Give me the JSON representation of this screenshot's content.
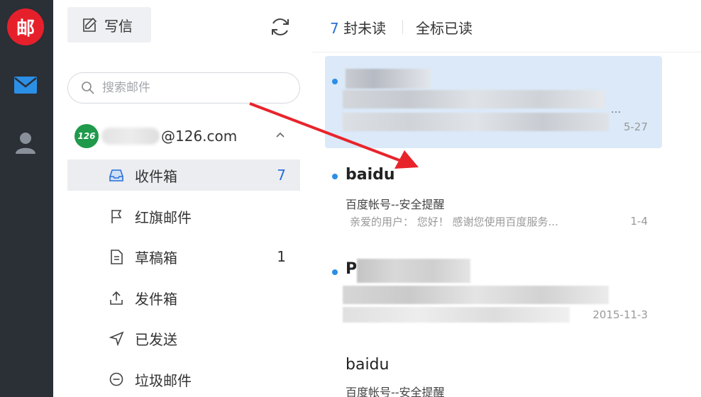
{
  "rail": {
    "logo_text": "邮",
    "icons": [
      "mail-icon",
      "contact-icon"
    ]
  },
  "nav": {
    "compose_label": "写信",
    "search_placeholder": "搜索邮件",
    "account": {
      "badge": "126",
      "email": "@126.com"
    },
    "folders": [
      {
        "label": "收件箱",
        "count": "7",
        "icon": "inbox-icon"
      },
      {
        "label": "红旗邮件",
        "count": "",
        "icon": "flag-icon"
      },
      {
        "label": "草稿箱",
        "count": "1",
        "icon": "draft-icon"
      },
      {
        "label": "发件箱",
        "count": "",
        "icon": "outbox-icon"
      },
      {
        "label": "已发送",
        "count": "",
        "icon": "sent-icon"
      },
      {
        "label": "垃圾邮件",
        "count": "",
        "icon": "spam-icon"
      }
    ]
  },
  "list": {
    "unread_count": "7",
    "unread_suffix": "封未读",
    "mark_all_read": "全标已读",
    "mails": [
      {
        "sender": "",
        "subject": "",
        "preview": "...",
        "date": "5-27",
        "unread": true
      },
      {
        "sender": "baidu",
        "subject": "百度帐号--安全提醒",
        "preview": "亲爱的用户： 您好！ 感谢您使用百度服务...",
        "date": "1-4",
        "unread": true
      },
      {
        "sender": "P",
        "subject": "",
        "preview": "",
        "date": "2015-11-3",
        "unread": true
      },
      {
        "sender": "baidu",
        "subject": "百度帐号--安全提醒",
        "preview": "",
        "date": "",
        "unread": false
      }
    ]
  },
  "colors": {
    "rail_bg": "#2b2f36",
    "logo_red": "#e6202b",
    "accent_blue": "#2b6fd6",
    "selected_bg": "#dbe9f8",
    "arrow_red": "#e8242b"
  }
}
